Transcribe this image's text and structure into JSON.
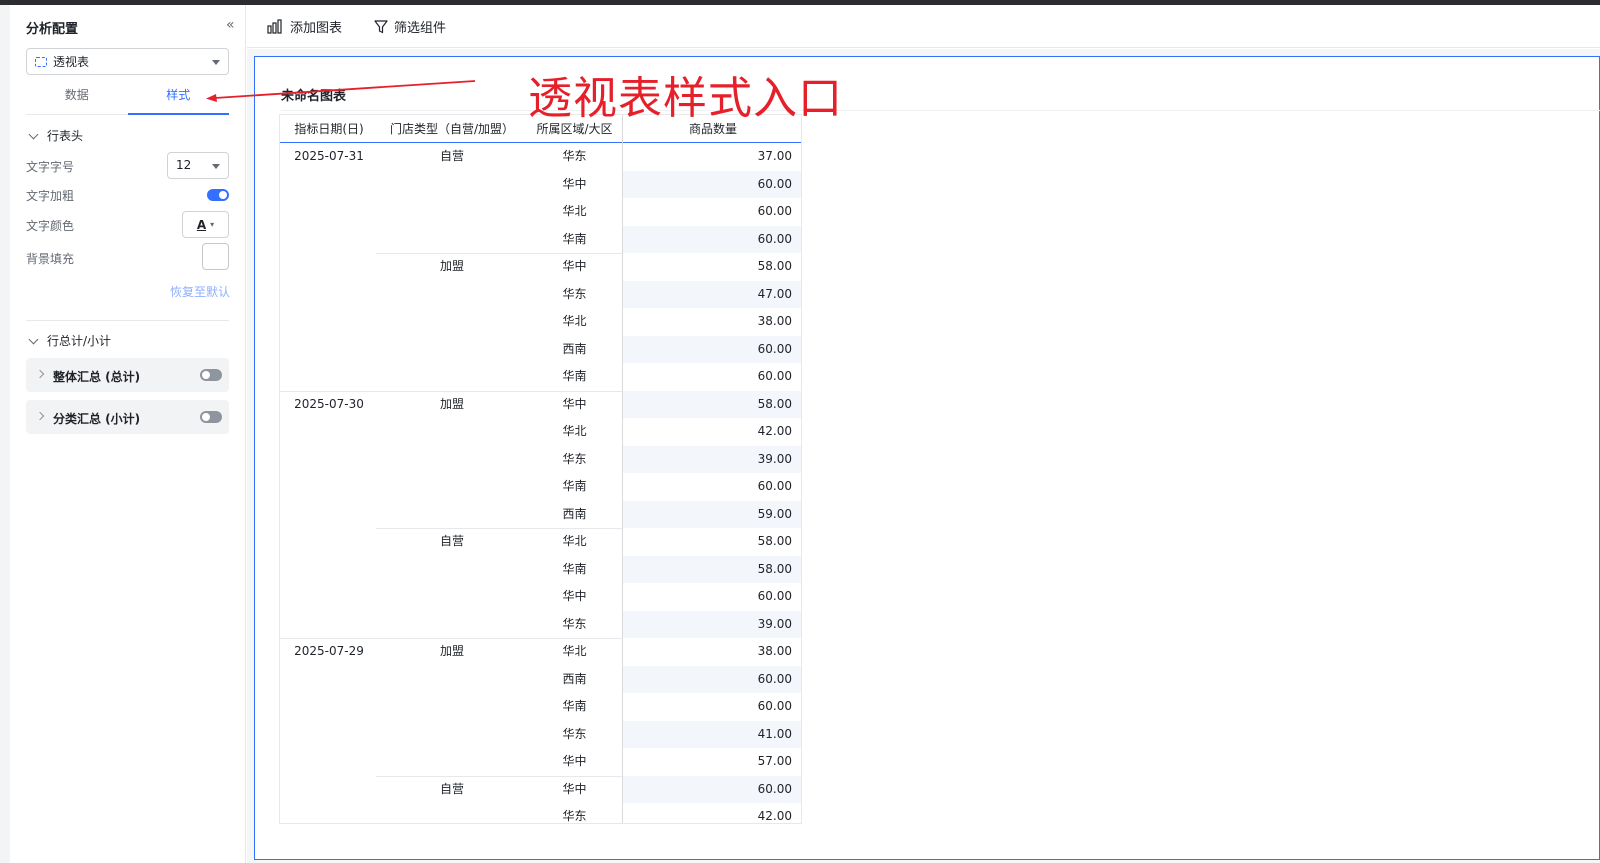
{
  "sidebar": {
    "title": "分析配置",
    "collapse_icon": "«",
    "chart_type": "透视表",
    "tabs": [
      "数据",
      "样式"
    ],
    "active_tab": "样式",
    "row_header_section": "行表头",
    "font_size_label": "文字字号",
    "font_size_value": "12",
    "bold_label": "文字加粗",
    "bold_on": true,
    "color_label": "文字颜色",
    "color_btn_glyph": "A",
    "bg_label": "背景填充",
    "reset_label": "恢复至默认",
    "totals_section": "行总计/小计",
    "grand_total_label": "整体汇总 (总计)",
    "subtotal_label": "分类汇总 (小计)"
  },
  "toolbar": {
    "add_chart": "添加图表",
    "filter_widget": "筛选组件"
  },
  "chart": {
    "title": "未命名图表",
    "columns": [
      "指标日期(日)",
      "门店类型（自营/加盟）",
      "所属区域/大区",
      "商品数量"
    ],
    "rows": [
      {
        "date": "2025-07-31",
        "type": "自营",
        "region": "华东",
        "qty": "37.00"
      },
      {
        "date": "",
        "type": "",
        "region": "华中",
        "qty": "60.00"
      },
      {
        "date": "",
        "type": "",
        "region": "华北",
        "qty": "60.00"
      },
      {
        "date": "",
        "type": "",
        "region": "华南",
        "qty": "60.00"
      },
      {
        "date": "",
        "type": "加盟",
        "region": "华中",
        "qty": "58.00"
      },
      {
        "date": "",
        "type": "",
        "region": "华东",
        "qty": "47.00"
      },
      {
        "date": "",
        "type": "",
        "region": "华北",
        "qty": "38.00"
      },
      {
        "date": "",
        "type": "",
        "region": "西南",
        "qty": "60.00"
      },
      {
        "date": "",
        "type": "",
        "region": "华南",
        "qty": "60.00"
      },
      {
        "date": "2025-07-30",
        "type": "加盟",
        "region": "华中",
        "qty": "58.00"
      },
      {
        "date": "",
        "type": "",
        "region": "华北",
        "qty": "42.00"
      },
      {
        "date": "",
        "type": "",
        "region": "华东",
        "qty": "39.00"
      },
      {
        "date": "",
        "type": "",
        "region": "华南",
        "qty": "60.00"
      },
      {
        "date": "",
        "type": "",
        "region": "西南",
        "qty": "59.00"
      },
      {
        "date": "",
        "type": "自营",
        "region": "华北",
        "qty": "58.00"
      },
      {
        "date": "",
        "type": "",
        "region": "华南",
        "qty": "58.00"
      },
      {
        "date": "",
        "type": "",
        "region": "华中",
        "qty": "60.00"
      },
      {
        "date": "",
        "type": "",
        "region": "华东",
        "qty": "39.00"
      },
      {
        "date": "2025-07-29",
        "type": "加盟",
        "region": "华北",
        "qty": "38.00"
      },
      {
        "date": "",
        "type": "",
        "region": "西南",
        "qty": "60.00"
      },
      {
        "date": "",
        "type": "",
        "region": "华南",
        "qty": "60.00"
      },
      {
        "date": "",
        "type": "",
        "region": "华东",
        "qty": "41.00"
      },
      {
        "date": "",
        "type": "",
        "region": "华中",
        "qty": "57.00"
      },
      {
        "date": "",
        "type": "自营",
        "region": "华中",
        "qty": "60.00"
      },
      {
        "date": "",
        "type": "",
        "region": "华东",
        "qty": "42.00"
      }
    ]
  },
  "annotation": {
    "text": "透视表样式入口",
    "color": "#e5202a"
  },
  "colors": {
    "accent": "#3370ff"
  }
}
